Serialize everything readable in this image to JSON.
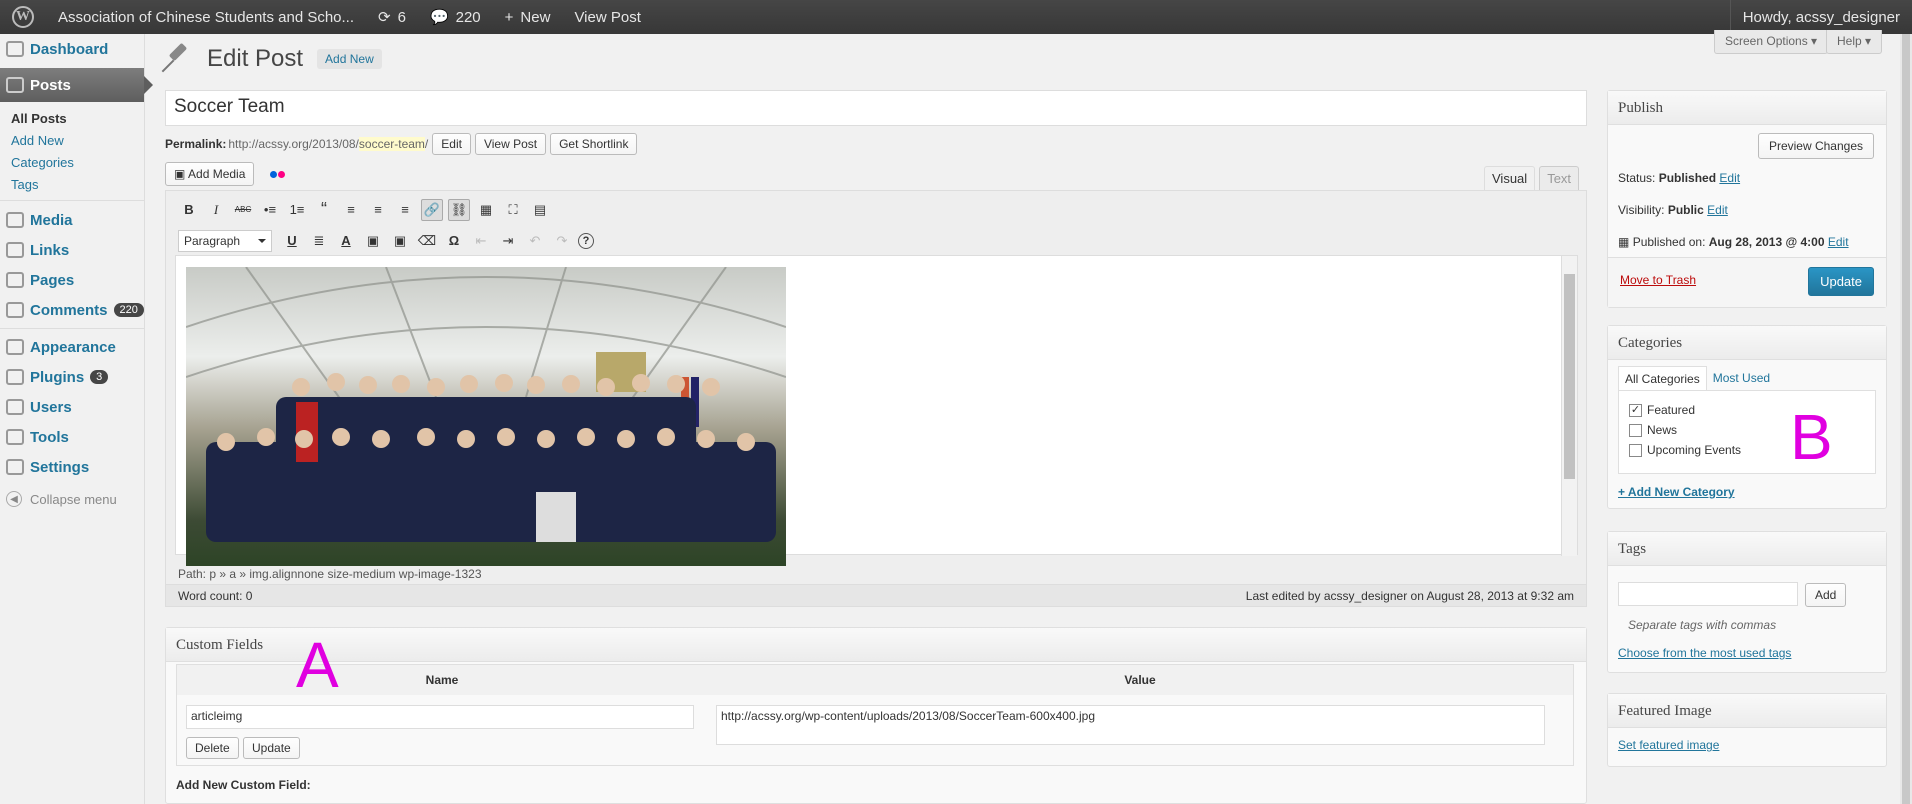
{
  "adminbar": {
    "site": "Association of Chinese Students and Scho...",
    "updates": "6",
    "comments": "220",
    "new_label": "New",
    "view_post": "View Post",
    "howdy": "Howdy, acssy_designer"
  },
  "menu": {
    "dashboard": "Dashboard",
    "posts": "Posts",
    "posts_sub": [
      "All Posts",
      "Add New",
      "Categories",
      "Tags"
    ],
    "media": "Media",
    "links": "Links",
    "pages": "Pages",
    "comments": "Comments",
    "comments_count": "220",
    "appearance": "Appearance",
    "plugins": "Plugins",
    "plugins_count": "3",
    "users": "Users",
    "tools": "Tools",
    "settings": "Settings",
    "collapse": "Collapse menu"
  },
  "screen_options": "Screen Options ▾",
  "help": "Help ▾",
  "page": {
    "title": "Edit Post",
    "add_new": "Add New"
  },
  "post": {
    "title": "Soccer Team",
    "permalink_label": "Permalink:",
    "permalink_base": "http://acssy.org/2013/08/",
    "permalink_slug": "soccer-team",
    "permalink_end": "/",
    "edit": "Edit",
    "view_post": "View Post",
    "get_shortlink": "Get Shortlink"
  },
  "editor": {
    "add_media": "Add Media",
    "tab_visual": "Visual",
    "tab_text": "Text",
    "format": "Paragraph",
    "path": "Path: p » a » img.alignnone size-medium wp-image-1323",
    "word_count": "Word count: 0",
    "last_edited": "Last edited by acssy_designer on August 28, 2013 at 9:32 am"
  },
  "toolbar_row1": [
    "B",
    "I",
    "ABC",
    "•≡",
    "1≡",
    "“",
    "≡",
    "≡",
    "≡",
    "🔗",
    "⛓",
    "▦",
    "⛶",
    "▤"
  ],
  "toolbar_row2": [
    "U",
    "≣",
    "A",
    "▣",
    "▣",
    "⌫",
    "Ω",
    "⇤",
    "⇥",
    "↶",
    "↷",
    "?"
  ],
  "custom_fields": {
    "title": "Custom Fields",
    "name_header": "Name",
    "value_header": "Value",
    "name": "articleimg",
    "value": "http://acssy.org/wp-content/uploads/2013/08/SoccerTeam-600x400.jpg",
    "delete": "Delete",
    "update": "Update",
    "add_new": "Add New Custom Field:"
  },
  "publish": {
    "title": "Publish",
    "preview": "Preview Changes",
    "status_label": "Status:",
    "status": "Published",
    "visibility_label": "Visibility:",
    "visibility": "Public",
    "published_on_label": "Published on:",
    "published_on": "Aug 28, 2013 @ 4:00",
    "edit": "Edit",
    "trash": "Move to Trash",
    "update": "Update"
  },
  "categories": {
    "title": "Categories",
    "tab_all": "All Categories",
    "tab_used": "Most Used",
    "items": [
      {
        "label": "Featured",
        "checked": "✓"
      },
      {
        "label": "News",
        "checked": ""
      },
      {
        "label": "Upcoming Events",
        "checked": ""
      }
    ],
    "add_new": "+ Add New Category"
  },
  "tags": {
    "title": "Tags",
    "add": "Add",
    "hint": "Separate tags with commas",
    "choose": "Choose from the most used tags"
  },
  "featured_image": {
    "title": "Featured Image",
    "set": "Set featured image"
  },
  "annotations": {
    "a": "A",
    "b": "B"
  },
  "colors": {
    "link": "#21759b",
    "adminbar": "#464646",
    "update_button": "#21759b",
    "annotation": "#e000e0"
  }
}
